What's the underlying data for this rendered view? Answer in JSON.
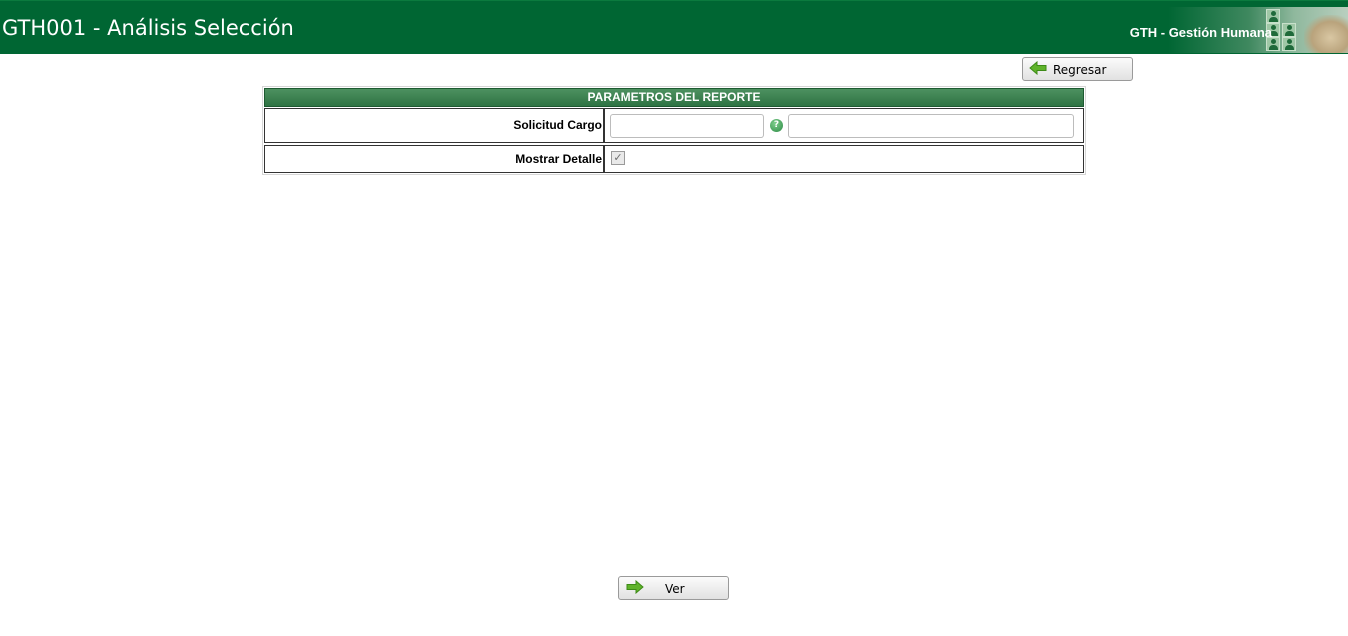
{
  "header": {
    "title": "GTH001 - Análisis Selección",
    "subtitle": "GTH - Gestión Humana"
  },
  "toolbar": {
    "back_label": "Regresar"
  },
  "params": {
    "header": "PARAMETROS DEL REPORTE",
    "rows": [
      {
        "label": "Solicitud Cargo",
        "code_value": "",
        "description_value": "",
        "help_icon": "help-icon"
      },
      {
        "label": "Mostrar Detalle",
        "checked": true
      }
    ]
  },
  "footer": {
    "view_label": "Ver"
  },
  "colors": {
    "header_bg": "#006633",
    "section_header": "#3b8050",
    "arrow_green": "#5fb32a"
  }
}
